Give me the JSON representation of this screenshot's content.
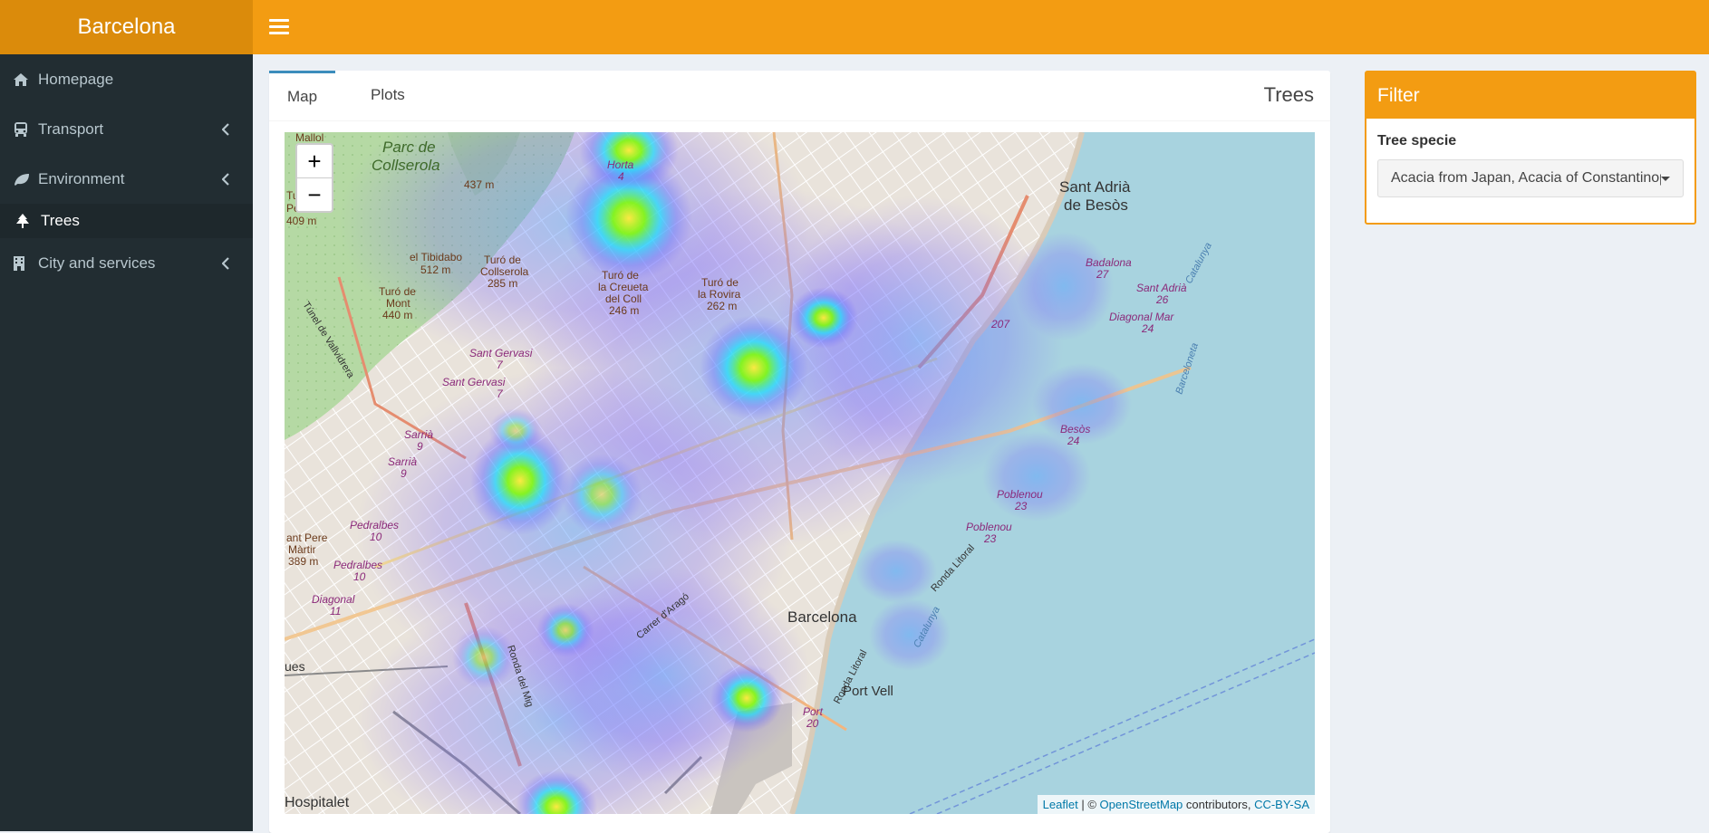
{
  "app": {
    "title": "Barcelona"
  },
  "sidebar": {
    "items": [
      {
        "label": "Homepage",
        "icon": "home-icon",
        "has_submenu": false,
        "active": false
      },
      {
        "label": "Transport",
        "icon": "bus-icon",
        "has_submenu": true,
        "active": false
      },
      {
        "label": "Environment",
        "icon": "leaf-icon",
        "has_submenu": true,
        "active": false
      },
      {
        "label": "Trees",
        "icon": "tree-icon",
        "has_submenu": false,
        "active": true
      },
      {
        "label": "City and services",
        "icon": "building-icon",
        "has_submenu": true,
        "active": false
      }
    ]
  },
  "main": {
    "tabs": [
      {
        "label": "Map",
        "active": true
      },
      {
        "label": "Plots",
        "active": false
      }
    ],
    "title": "Trees",
    "map": {
      "zoom_in": "+",
      "zoom_out": "−",
      "attribution": {
        "leaflet": "Leaflet",
        "sep": " | © ",
        "osm": "OpenStreetMap",
        "contributors": " contributors, ",
        "license": "CC-BY-SA"
      },
      "labels": {
        "parc": "Parc de",
        "collserola": "Collserola",
        "horta": "Horta",
        "horta_num": "4",
        "santadria": "Sant Adrià",
        "debesos": "de Besòs",
        "badalona": "Badalona",
        "badalona_num": "27",
        "tibidabo": "el Tibidabo",
        "tibidabo_alt": "512 m",
        "turo_collserola": "Turó de",
        "turo_collserola2": "Collserola",
        "turo_collserola_alt": "285 m",
        "turo_crueta": "Turó de",
        "turo_crueta2": "la Creueta",
        "turo_crueta3": "del Coll",
        "turo_crueta_alt": "246 m",
        "turo_rovira": "Turó de",
        "turo_rovira2": "la Rovira",
        "turo_rovira_alt": "262 m",
        "turo_mont": "Turó de",
        "turo_mont2": "Mont",
        "turo_mont_alt": "440 m",
        "alt437": "437 m",
        "mallol": "Mallol",
        "turo_left": "Turó",
        "penitent": "Penitent",
        "alt409": "409 m",
        "santgervasi": "Sant Gervasi",
        "santgervasi_num": "7",
        "santgervasi2": "Sant Gervasi",
        "santgervasi2_num": "7",
        "sarria": "Sarrià",
        "sarria_num": "9",
        "sarria2": "Sarrià",
        "sarria2_num": "9",
        "pedralbes": "Pedralbes",
        "pedralbes_num": "10",
        "pedralbes2": "Pedralbes",
        "pedralbes2_num": "10",
        "santpere": "ant Pere",
        "martir": "Màrtir",
        "alt389": "389 m",
        "diagonal": "Diagonal",
        "diagonal_num": "11",
        "santadria2": "Sant Adrià",
        "santadria2_num": "26",
        "diagonalmar": "Diagonal Mar",
        "diagonalmar_num": "24",
        "besos": "Besòs",
        "besos_num": "24",
        "poblenou": "Poblenou",
        "poblenou_num": "23",
        "poblenou2": "Poblenou",
        "poblenou2_num": "23",
        "barcelona": "Barcelona",
        "portvell": "Port Vell",
        "port": "Port",
        "port_num": "20",
        "hospitalet": "Hospitalet",
        "ues": "ues",
        "r207": "207",
        "carrer_arago": "Carrer d'Aragó",
        "ronda_mig": "Ronda del Mig",
        "ronda_litoral": "Ronda Litoral",
        "ronda_litoral2": "Ronda Litoral",
        "tunel": "Túnel de Vallvidrera",
        "catalunya": "Catalunya",
        "catalunya2": "Catalunya",
        "barceloneta": "Barceloneta"
      }
    }
  },
  "filter": {
    "title": "Filter",
    "label": "Tree specie",
    "selected": "Acacia from Japan, Acacia of Constantinople"
  },
  "colors": {
    "header": "#f39c12",
    "logo_bg": "#db8b0b",
    "sidebar": "#222d32",
    "accent": "#3c8dbc",
    "sea": "#a8d3df"
  }
}
